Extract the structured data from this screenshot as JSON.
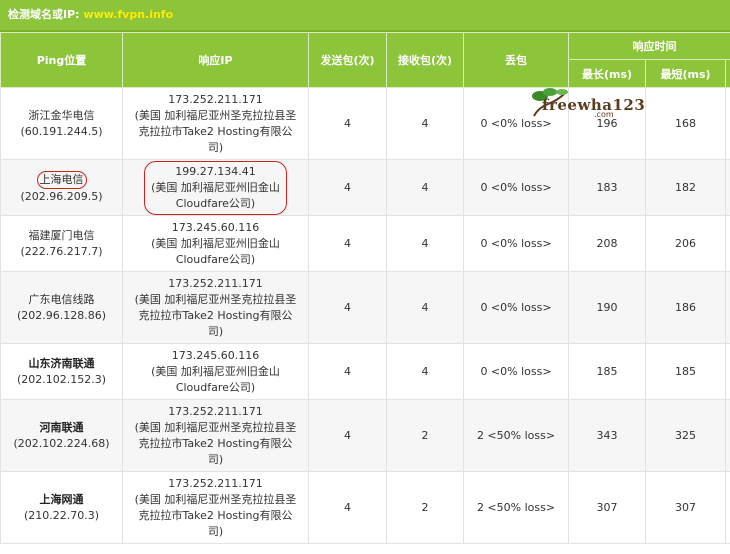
{
  "header": {
    "label": "检测域名或IP:",
    "domain": "www.fvpn.info"
  },
  "columns": {
    "location": "Ping位置",
    "ip": "响应IP",
    "sent": "发送包(次)",
    "received": "接收包(次)",
    "loss": "丢包",
    "resp_time": "响应时间",
    "max": "最长(ms)",
    "min": "最短(ms)"
  },
  "watermark": {
    "text": "freewha123",
    "sub": ".com"
  },
  "rows": [
    {
      "location": "浙江金华电信",
      "location_ip": "(60.191.244.5)",
      "ip_lines": [
        "173.252.211.171",
        "(美国 加利福尼亚州圣克拉拉县圣",
        "克拉拉市Take2 Hosting有限公",
        "司)"
      ],
      "sent": "4",
      "received": "4",
      "loss": "0 <0% loss>",
      "max": "196",
      "min": "168"
    },
    {
      "location": "上海电信",
      "location_ip": "(202.96.209.5)",
      "ip_lines": [
        "199.27.134.41",
        "(美国 加利福尼亚州旧金山",
        "Cloudfare公司)"
      ],
      "sent": "4",
      "received": "4",
      "loss": "0 <0% loss>",
      "max": "183",
      "min": "182"
    },
    {
      "location": "福建厦门电信",
      "location_ip": "(222.76.217.7)",
      "ip_lines": [
        "173.245.60.116",
        "(美国 加利福尼亚州旧金山",
        "Cloudfare公司)"
      ],
      "sent": "4",
      "received": "4",
      "loss": "0 <0% loss>",
      "max": "208",
      "min": "206"
    },
    {
      "location": "广东电信线路",
      "location_ip": "(202.96.128.86)",
      "ip_lines": [
        "173.252.211.171",
        "(美国 加利福尼亚州圣克拉拉县圣",
        "克拉拉市Take2 Hosting有限公",
        "司)"
      ],
      "sent": "4",
      "received": "4",
      "loss": "0 <0% loss>",
      "max": "190",
      "min": "186"
    },
    {
      "location": "山东济南联通",
      "location_ip": "(202.102.152.3)",
      "ip_lines": [
        "173.245.60.116",
        "(美国 加利福尼亚州旧金山",
        "Cloudfare公司)"
      ],
      "sent": "4",
      "received": "4",
      "loss": "0 <0% loss>",
      "max": "185",
      "min": "185"
    },
    {
      "location": "河南联通",
      "location_ip": "(202.102.224.68)",
      "ip_lines": [
        "173.252.211.171",
        "(美国 加利福尼亚州圣克拉拉县圣",
        "克拉拉市Take2 Hosting有限公",
        "司)"
      ],
      "sent": "4",
      "received": "2",
      "loss": "2 <50% loss>",
      "max": "343",
      "min": "325"
    },
    {
      "location": "上海网通",
      "location_ip": "(210.22.70.3)",
      "ip_lines": [
        "173.252.211.171",
        "(美国 加利福尼亚州圣克拉拉县圣",
        "克拉拉市Take2 Hosting有限公",
        "司)"
      ],
      "sent": "4",
      "received": "2",
      "loss": "2 <50% loss>",
      "max": "307",
      "min": "307"
    }
  ]
}
